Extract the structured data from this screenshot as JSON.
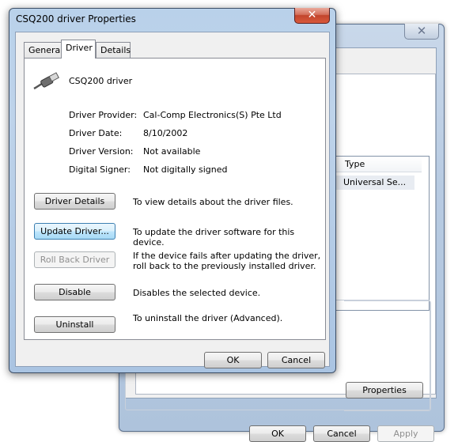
{
  "background_window": {
    "close_glyph": "✕",
    "list_column_type": "Type",
    "list_cell_type": "Universal Se...",
    "properties_label": "Properties",
    "ok_label": "OK",
    "cancel_label": "Cancel",
    "apply_label": "Apply"
  },
  "dialog": {
    "title": "CSQ200 driver Properties",
    "close_glyph": "✕",
    "tabs": [
      {
        "label": "General"
      },
      {
        "label": "Driver"
      },
      {
        "label": "Details"
      }
    ],
    "device_icon": "usb-cable-icon",
    "device_name": "CSQ200 driver",
    "info": [
      {
        "label": "Driver Provider:",
        "value": "Cal-Comp Electronics(S) Pte Ltd"
      },
      {
        "label": "Driver Date:",
        "value": "8/10/2002"
      },
      {
        "label": "Driver Version:",
        "value": "Not available"
      },
      {
        "label": "Digital Signer:",
        "value": "Not digitally signed"
      }
    ],
    "actions": [
      {
        "label": "Driver Details",
        "description": "To view details about the driver files."
      },
      {
        "label": "Update Driver...",
        "description": "To update the driver software for this device."
      },
      {
        "label": "Roll Back Driver",
        "description": "If the device fails after updating the driver, roll back to the previously installed driver."
      },
      {
        "label": "Disable",
        "description": "Disables the selected device."
      },
      {
        "label": "Uninstall",
        "description": "To uninstall the driver (Advanced)."
      }
    ],
    "ok_label": "OK",
    "cancel_label": "Cancel"
  }
}
